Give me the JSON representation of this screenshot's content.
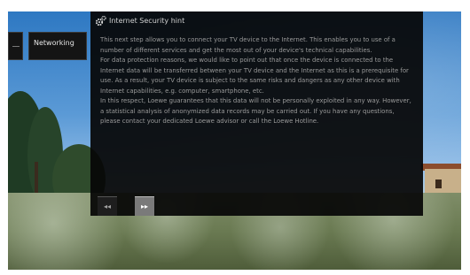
{
  "sidebar": {
    "tab_label": "Networking"
  },
  "dialog": {
    "title": "Internet Security hint",
    "paragraphs": [
      "This next step allows you to connect your TV device to the Internet. This enables you to use of a number of different services and get the most out of your device's technical capabilities.",
      "For data protection reasons, we would like to point out that once the device is connected to the Internet data will be transferred between your TV device and the Internet as this is a prerequisite for use. As a result, your TV device is subject to the same risks and dangers as any other device with Internet capabilities, e.g. computer, smartphone, etc.",
      "In this respect, Loewe guarantees that this data will not be personally exploited in any way. However, a statistical analysis of anonymized data records may be carried out. If you have any questions, please contact your dedicated Loewe advisor or call the Loewe Hotline."
    ],
    "icon": "gear-icon"
  },
  "buttons": {
    "back_glyph": "◂◂",
    "next_glyph": "▸▸"
  },
  "colors": {
    "dialog_bg": "#060606",
    "text": "#9a9a9a",
    "title": "#d0d0d0",
    "next_button": "#7a7a7a"
  }
}
